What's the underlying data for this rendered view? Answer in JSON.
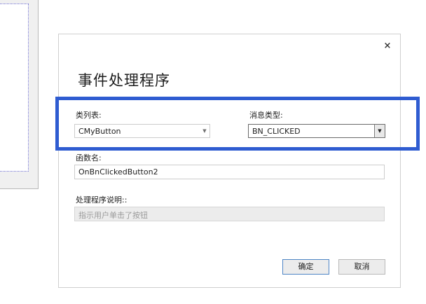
{
  "dialog": {
    "title": "事件处理程序",
    "close_glyph": "×",
    "class_list": {
      "label": "类列表:",
      "value": "CMyButton"
    },
    "message_type": {
      "label": "消息类型:",
      "value": "BN_CLICKED"
    },
    "function_name": {
      "label": "函数名:",
      "value": "OnBnClickedButton2"
    },
    "handler_description": {
      "label": "处理程序说明::",
      "value": "指示用户单击了按钮"
    },
    "ok_label": "确定",
    "cancel_label": "取消"
  },
  "icons": {
    "close": "close-icon",
    "dropdown": "chevron-down-icon"
  },
  "colors": {
    "highlight": "#2f5cd1",
    "primary_button_border": "#4f86c6"
  }
}
